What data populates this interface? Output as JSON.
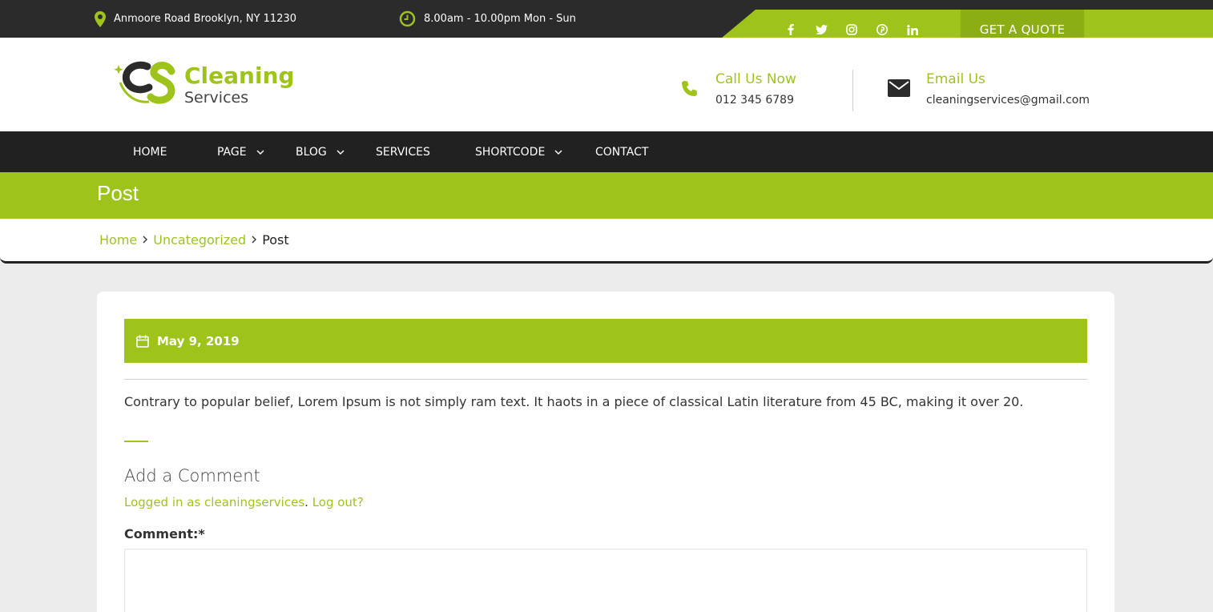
{
  "topbar": {
    "address": "Anmoore Road Brooklyn, NY 11230",
    "hours": "8.00am - 10.00pm Mon - Sun",
    "socials": [
      "f",
      "t",
      "ig",
      "p",
      "in"
    ],
    "quote_label": "GET A QUOTE"
  },
  "header": {
    "logo_title": "Cleaning",
    "logo_sub": "Services",
    "call_label": "Call Us Now",
    "call_value": "012 345 6789",
    "email_label": "Email Us",
    "email_value": "cleaningservices@gmail.com"
  },
  "nav": {
    "items": [
      "HOME",
      "PAGE",
      "BLOG",
      "SERVICES",
      "SHORTCODE",
      "CONTACT"
    ]
  },
  "page": {
    "title": "Post",
    "breadcrumb": [
      "Home",
      "Uncategorized",
      "Post"
    ]
  },
  "post": {
    "date": "May 9, 2019",
    "text": "Contrary to popular belief, Lorem Ipsum is not simply ram text. It haots in a piece of classical Latin literature from 45 BC, making it over 20.",
    "comment_title": "Add a Comment",
    "logged_in_as": "Logged in as cleaningservices",
    "log_out": "Log out?",
    "comment_label": "Comment:*"
  },
  "colors": {
    "accent": "#9ec41c",
    "dark": "#212121"
  }
}
